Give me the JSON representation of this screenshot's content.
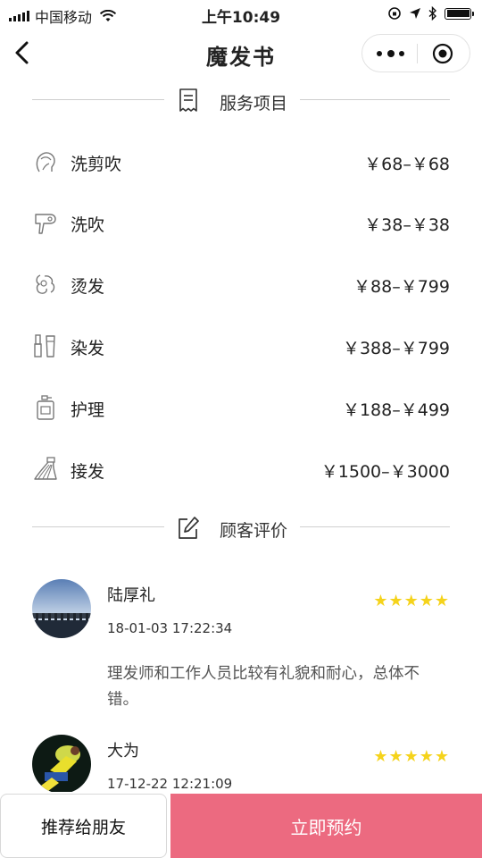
{
  "status_bar": {
    "carrier": "中国移动",
    "time": "上午10:49",
    "battery_level": 1.0
  },
  "nav": {
    "title": "魔发书"
  },
  "services_section": {
    "title": "服务项目",
    "icon": "receipt-icon",
    "items": [
      {
        "name": "洗剪吹",
        "price": "￥68–￥68",
        "icon": "head-icon"
      },
      {
        "name": "洗吹",
        "price": "￥38–￥38",
        "icon": "hair-dryer-icon"
      },
      {
        "name": "烫发",
        "price": "￥88–￥799",
        "icon": "curl-icon"
      },
      {
        "name": "染发",
        "price": "￥388–￥799",
        "icon": "dye-brush-icon"
      },
      {
        "name": "护理",
        "price": "￥188–￥499",
        "icon": "care-bottle-icon"
      },
      {
        "name": "接发",
        "price": "￥1500–￥3000",
        "icon": "hair-extension-icon"
      }
    ]
  },
  "reviews_section": {
    "title": "顾客评价",
    "icon": "edit-icon",
    "items": [
      {
        "name": "陆厚礼",
        "time": "18-01-03 17:22:34",
        "rating": 5,
        "stars": "★★★★★",
        "text": "理发师和工作人员比较有礼貌和耐心，总体不错。"
      },
      {
        "name": "大为",
        "time": "17-12-22 12:21:09",
        "rating": 5,
        "stars": "★★★★★",
        "text": ""
      }
    ]
  },
  "bottom": {
    "share_label": "推荐给朋友",
    "book_label": "立即预约"
  },
  "colors": {
    "star": "#f5d31b",
    "book_button": "#ec6a80",
    "divider": "#cfcfcf"
  }
}
